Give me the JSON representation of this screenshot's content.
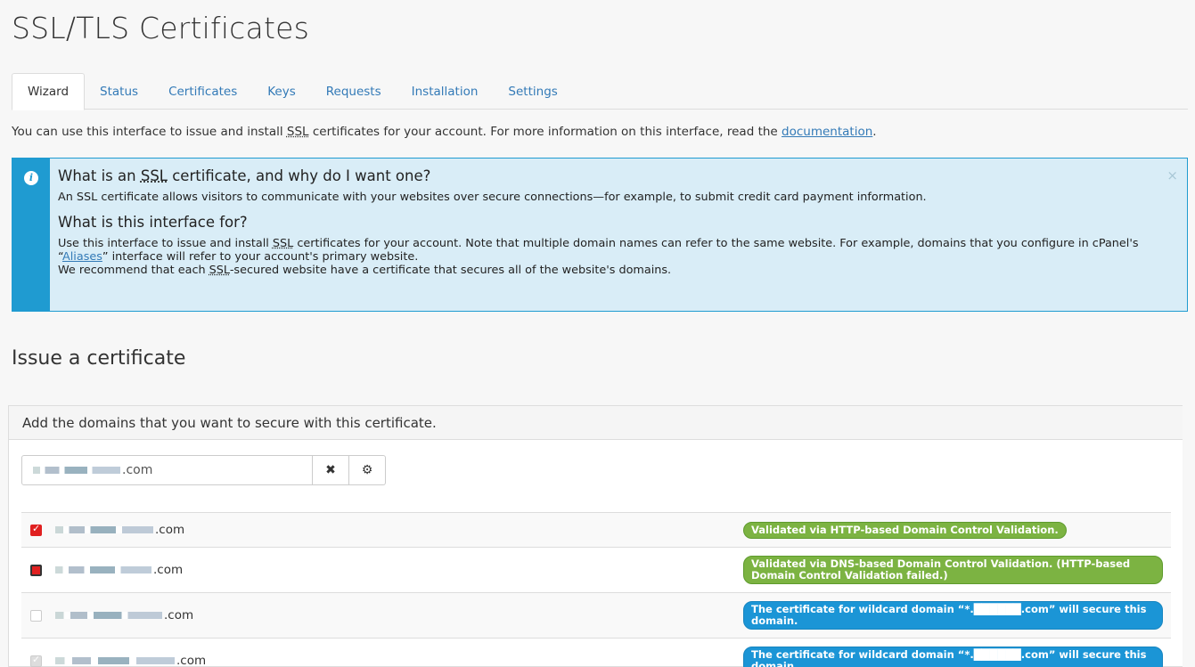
{
  "page": {
    "title": "SSL/TLS Certificates"
  },
  "tabs": [
    {
      "label": "Wizard"
    },
    {
      "label": "Status"
    },
    {
      "label": "Certificates"
    },
    {
      "label": "Keys"
    },
    {
      "label": "Requests"
    },
    {
      "label": "Installation"
    },
    {
      "label": "Settings"
    }
  ],
  "intro": {
    "prefix": "You can use this interface to issue and install ",
    "ssl": "SSL",
    "middle": " certificates for your account. For more information on this interface, read the ",
    "link": "documentation",
    "suffix": "."
  },
  "info": {
    "close": "×",
    "h1_prefix": "What is an ",
    "h1_ssl": "SSL",
    "h1_suffix": " certificate, and why do I want one?",
    "p1": "An SSL certificate allows visitors to communicate with your websites over secure connections—for example, to submit credit card payment information.",
    "h2": "What is this interface for?",
    "p2_a": "Use this interface to issue and install ",
    "p2_ssl": "SSL",
    "p2_b": " certificates for your account. Note that multiple domain names can refer to the same website. For example, domains that you configure in cPanel's “",
    "p2_link": "Aliases",
    "p2_c": "” interface will refer to your account's primary website.",
    "p3_a": "We recommend that each ",
    "p3_ssl": "SSL",
    "p3_b": "-secured website have a certificate that secures all of the website's domains."
  },
  "issue": {
    "title": "Issue a certificate",
    "panel_heading": "Add the domains that you want to secure with this certificate.",
    "input_value_suffix": ".com",
    "clear_icon": "✖",
    "options_icon": "⚙"
  },
  "domains": [
    {
      "suffix": ".com",
      "checked": "red",
      "badge": "Validated via HTTP-based Domain Control Validation.",
      "badge_color": "green"
    },
    {
      "suffix": ".com",
      "checked": "dark",
      "badge": "Validated via DNS-based Domain Control Validation. (HTTP-based Domain Control Validation failed.)",
      "badge_color": "green"
    },
    {
      "suffix": ".com",
      "checked": "none",
      "badge": "The certificate for wildcard domain “*.██████.com” will secure this domain.",
      "badge_color": "blue"
    },
    {
      "suffix": ".com",
      "checked": "gray",
      "badge": "The certificate for wildcard domain “*.██████.com” will secure this domain.",
      "badge_color": "blue"
    }
  ],
  "colors": {
    "info_accent": "#1f9bd1",
    "info_bg": "#d9edf7",
    "link": "#337ab7",
    "green_badge": "#7cb342",
    "blue_badge": "#1b95d6",
    "check_red": "#e02020"
  }
}
